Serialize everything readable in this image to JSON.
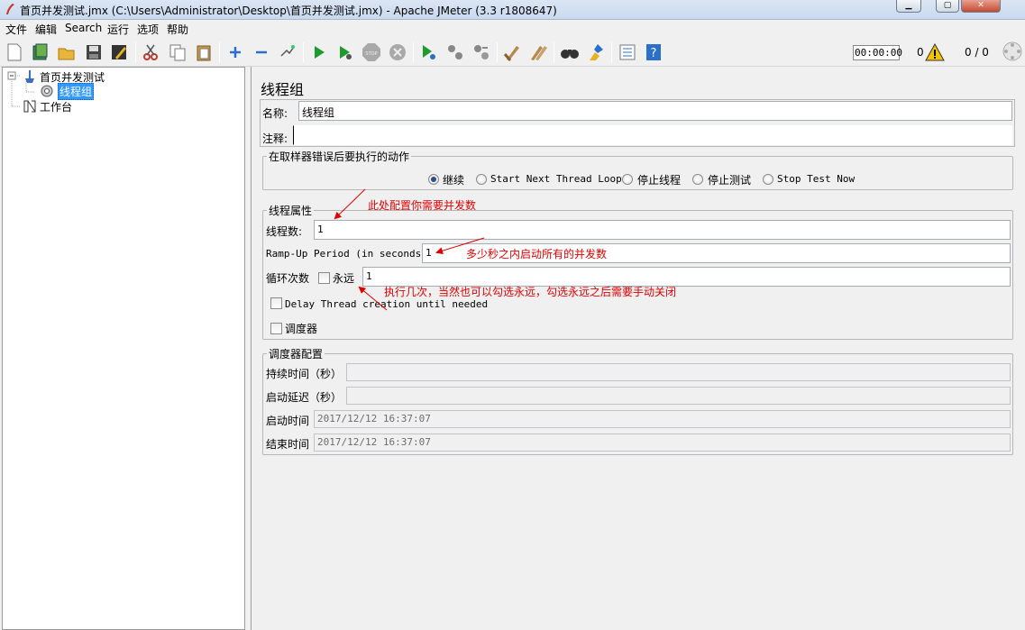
{
  "window": {
    "title": "首页并发测试.jmx (C:\\Users\\Administrator\\Desktop\\首页并发测试.jmx) - Apache JMeter (3.3 r1808647)"
  },
  "menu": [
    "文件",
    "编辑",
    "Search",
    "运行",
    "选项",
    "帮助"
  ],
  "toolbar": {
    "timer": "00:00:00",
    "warnings": "0",
    "threads": "0 / 0",
    "icons": [
      "new-icon",
      "templates-icon",
      "open-icon",
      "save-icon",
      "save-as-icon",
      "cut-icon",
      "copy-icon",
      "paste-icon",
      "expand-icon",
      "collapse-icon",
      "toggle-icon",
      "start-icon",
      "start-no-pause-icon",
      "stop-icon",
      "shutdown-icon",
      "remote-start-icon",
      "remote-stop-icon",
      "remote-exit-icon",
      "clear-icon",
      "clear-all-icon",
      "search-icon",
      "reset-search-icon",
      "function-helper-icon",
      "help-icon"
    ]
  },
  "tree": {
    "root": "首页并发测试",
    "thread_group": "线程组",
    "workbench": "工作台"
  },
  "panel": {
    "title": "线程组",
    "name_label": "名称:",
    "name_value": "线程组",
    "comment_label": "注释:",
    "comment_value": "",
    "on_error": {
      "legend": "在取样器错误后要执行的动作",
      "options": [
        "继续",
        "Start Next Thread Loop",
        "停止线程",
        "停止测试",
        "Stop Test Now"
      ],
      "selected": "继续"
    },
    "props": {
      "legend": "线程属性",
      "threads_label": "线程数:",
      "threads_value": "1",
      "rampup_label": "Ramp-Up Period (in seconds):",
      "rampup_value": "1",
      "loop_label": "循环次数",
      "forever_label": "永远",
      "forever_checked": false,
      "loop_value": "1",
      "delay_label": "Delay Thread creation until needed",
      "delay_checked": false,
      "scheduler_label": "调度器",
      "scheduler_checked": false
    },
    "sched": {
      "legend": "调度器配置",
      "duration_label": "持续时间（秒）",
      "duration_value": "",
      "delay_label": "启动延迟（秒）",
      "delay_value": "",
      "start_label": "启动时间",
      "start_value": "2017/12/12 16:37:07",
      "end_label": "结束时间",
      "end_value": "2017/12/12 16:37:07"
    }
  },
  "annotations": {
    "threads": "此处配置你需要并发数",
    "rampup": "多少秒之内启动所有的并发数",
    "loop": "执行几次，当然也可以勾选永远，勾选永远之后需要手动关闭"
  },
  "colors": {
    "annotation": "#e00000",
    "selection": "#3399ff"
  }
}
